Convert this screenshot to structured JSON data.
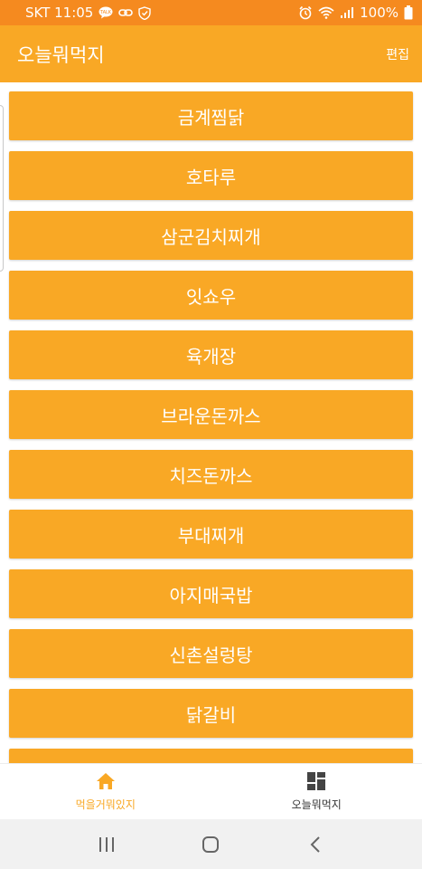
{
  "status_bar": {
    "carrier_time": "SKT 11:05",
    "battery": "100%",
    "left_icons": [
      "talk-icon",
      "link-icon",
      "shield-icon"
    ],
    "right_icons": [
      "alarm-icon",
      "wifi-icon",
      "signal-icon",
      "battery-icon"
    ]
  },
  "app_bar": {
    "title": "오늘뭐먹지",
    "edit_label": "편집"
  },
  "menu_items": [
    "금계찜닭",
    "호타루",
    "삼군김치찌개",
    "잇쇼우",
    "육개장",
    "브라운돈까스",
    "치즈돈까스",
    "부대찌개",
    "아지매국밥",
    "신촌설렁탕",
    "닭갈비",
    ""
  ],
  "bottom_nav": {
    "items": [
      {
        "label": "먹을거뭐있지",
        "icon": "home-icon",
        "active": true
      },
      {
        "label": "오늘뭐먹지",
        "icon": "dashboard-icon",
        "active": false
      }
    ]
  },
  "colors": {
    "status_bar": "#f58a1f",
    "primary": "#f9a825",
    "text_on_primary": "#ffffff"
  }
}
